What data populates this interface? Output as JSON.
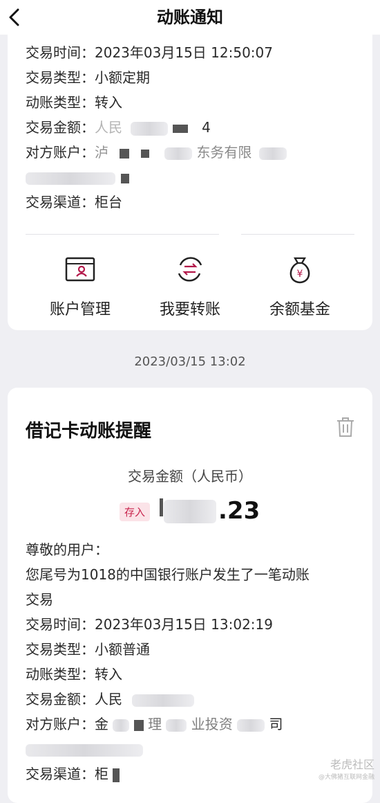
{
  "header": {
    "title": "动账通知"
  },
  "card1": {
    "rows": [
      {
        "label": "交易时间：",
        "value": "2023年03月15日 12:50:07"
      },
      {
        "label": "交易类型：",
        "value": "小额定期"
      },
      {
        "label": "动账类型：",
        "value": "转入"
      },
      {
        "label": "交易金额：",
        "value": "人民",
        "tail": "4"
      },
      {
        "label": "对方账户：",
        "value": "泸",
        "tail": "东务有限"
      },
      {
        "label": "交易渠道：",
        "value": "柜台"
      }
    ],
    "actions": [
      {
        "label": "账户管理",
        "icon": "account-card-icon"
      },
      {
        "label": "我要转账",
        "icon": "transfer-icon"
      },
      {
        "label": "余额基金",
        "icon": "money-bag-icon"
      }
    ]
  },
  "timestamp": "2023/03/15 13:02",
  "card2": {
    "title": "借记卡动账提醒",
    "amount_label": "交易金额（人民币）",
    "badge": "存入",
    "amount": ".23",
    "greeting": "尊敬的用户：",
    "message_line1": "您尾号为1018的中国银行账户发生了一笔动账",
    "message_line2": "交易",
    "rows": [
      {
        "label": "交易时间：",
        "value": "2023年03月15日 13:02:19"
      },
      {
        "label": "交易类型：",
        "value": "小额普通"
      },
      {
        "label": "动账类型：",
        "value": "转入"
      },
      {
        "label": "交易金额：",
        "value": "人民"
      },
      {
        "label": "对方账户：",
        "value": "金",
        "tail": "理",
        "tail2": "业投资",
        "tail3": "司"
      },
      {
        "label": "交易渠道：",
        "value": "柜"
      }
    ]
  },
  "watermark": {
    "line1": "老虎社区",
    "line2": "@大佛猪互联网金融"
  },
  "colors": {
    "accent": "#b3184a",
    "background": "#efeff3",
    "badge_bg": "#fbe3e8"
  }
}
